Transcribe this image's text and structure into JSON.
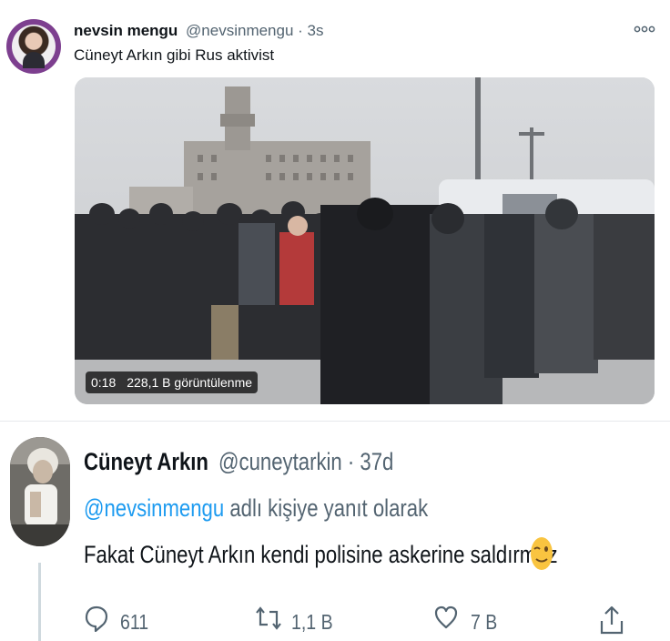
{
  "tweet": {
    "display_name": "nevsin mengu",
    "handle_time": "@nevsinmengu · 3s",
    "more_icon": "more-dots-icon",
    "text": "Cüneyt Arkın gibi Rus aktivist",
    "video": {
      "duration": "0:18",
      "views": "228,1 B görüntülenme"
    }
  },
  "reply": {
    "display_name": "Cüneyt Arkın",
    "handle_time": "@cuneytarkin · 37d",
    "replying_mention": "@nevsinmengu",
    "replying_suffix": " adlı kişiye yanıt olarak",
    "text": "Fakat Cüneyt Arkın kendi polisine askerine saldırmaz",
    "emoji": "winking-face-emoji"
  },
  "actions": {
    "reply_count": "611",
    "retweet_count": "1,1 B",
    "like_count": "7 B",
    "share_icon": "share-icon"
  },
  "colors": {
    "link": "#1d9bf0",
    "secondary_text": "#536471",
    "primary_text": "#0f1419"
  }
}
